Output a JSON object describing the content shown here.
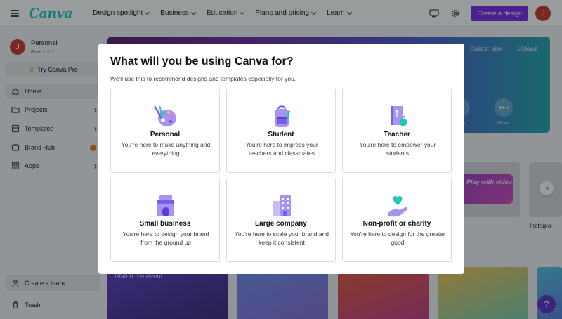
{
  "app": {
    "logo": "Canva"
  },
  "nav": [
    {
      "label": "Design spotlight"
    },
    {
      "label": "Business"
    },
    {
      "label": "Education"
    },
    {
      "label": "Plans and pricing"
    },
    {
      "label": "Learn"
    }
  ],
  "topbar": {
    "create_label": "Create a design",
    "avatar_initial": "J"
  },
  "account": {
    "name": "Personal",
    "plan": "Free",
    "members": "1",
    "avatar_initial": "J"
  },
  "sidebar": {
    "try_pro": "Try Canva Pro",
    "items": [
      {
        "label": "Home"
      },
      {
        "label": "Projects"
      },
      {
        "label": "Templates"
      },
      {
        "label": "Brand Hub"
      },
      {
        "label": "Apps"
      }
    ],
    "create_team": "Create a team",
    "trash": "Trash"
  },
  "background": {
    "custom_size": "Custom size",
    "upload": "Upload",
    "more_label": "More",
    "tile_label_fragment": "es",
    "play_card_text": "Play with video",
    "instagram_label": "Instagra",
    "watch_text": "Watch the event",
    "help": "?"
  },
  "modal": {
    "title": "What will you be using Canva for?",
    "subtitle": "We'll use this to recommend designs and templates especially for you.",
    "options": [
      {
        "title": "Personal",
        "description": "You're here to make anything and everything",
        "icon": "palette-icon"
      },
      {
        "title": "Student",
        "description": "You're here to impress your teachers and classmates",
        "icon": "backpack-icon"
      },
      {
        "title": "Teacher",
        "description": "You're here to empower your students",
        "icon": "book-apple-icon"
      },
      {
        "title": "Small business",
        "description": "You're here to design your brand from the ground up",
        "icon": "storefront-icon"
      },
      {
        "title": "Large company",
        "description": "You're here to scale your brand and keep it consistent",
        "icon": "office-building-icon"
      },
      {
        "title": "Non-profit or charity",
        "description": "You're here to design for the greater good",
        "icon": "heart-hand-icon"
      }
    ]
  },
  "colors": {
    "brand_purple": "#7d2ae8",
    "logo_teal": "#20c4cb",
    "icon_purple": "#8b6cf0",
    "icon_teal": "#23c9b5"
  }
}
